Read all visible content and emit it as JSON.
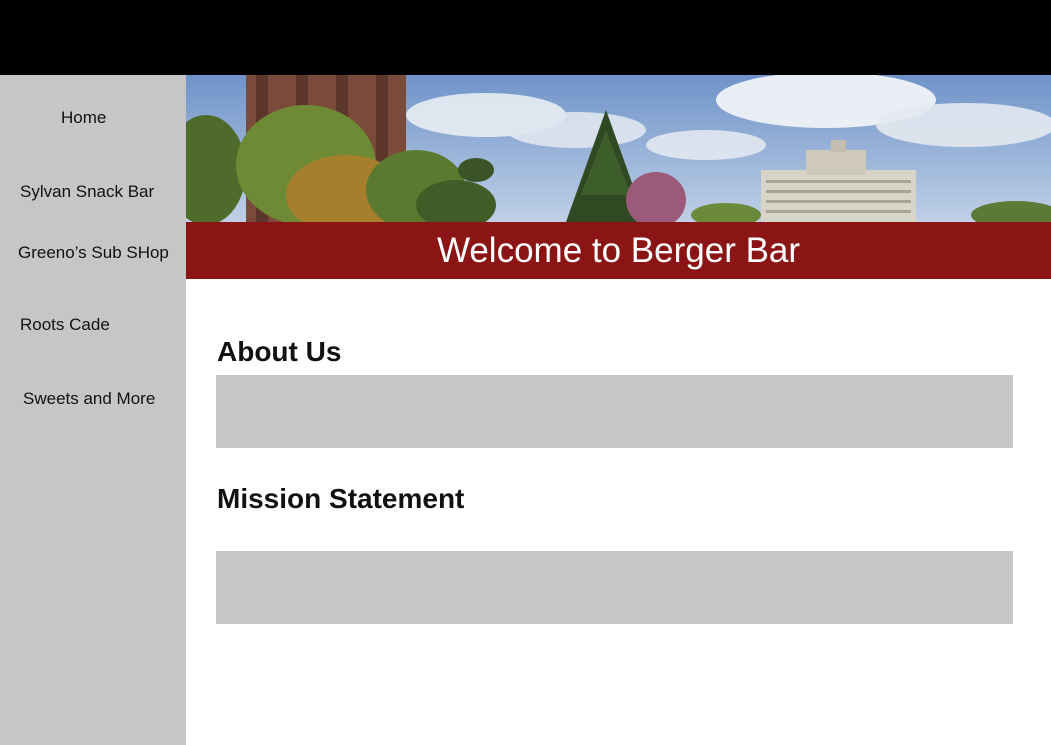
{
  "sidebar": {
    "items": [
      {
        "label": "Home"
      },
      {
        "label": "Sylvan Snack Bar"
      },
      {
        "label": "Greeno’s Sub SHop"
      },
      {
        "label": "Roots Cade"
      },
      {
        "label": "Sweets and More"
      }
    ]
  },
  "hero": {
    "title": "Welcome to Berger Bar"
  },
  "main": {
    "about_title": "About Us",
    "mission_title": "Mission Statement"
  },
  "colors": {
    "header": "#000000",
    "sidebar": "#c6c6c6",
    "accent": "#8b1414",
    "placeholder": "#c6c6c6"
  }
}
